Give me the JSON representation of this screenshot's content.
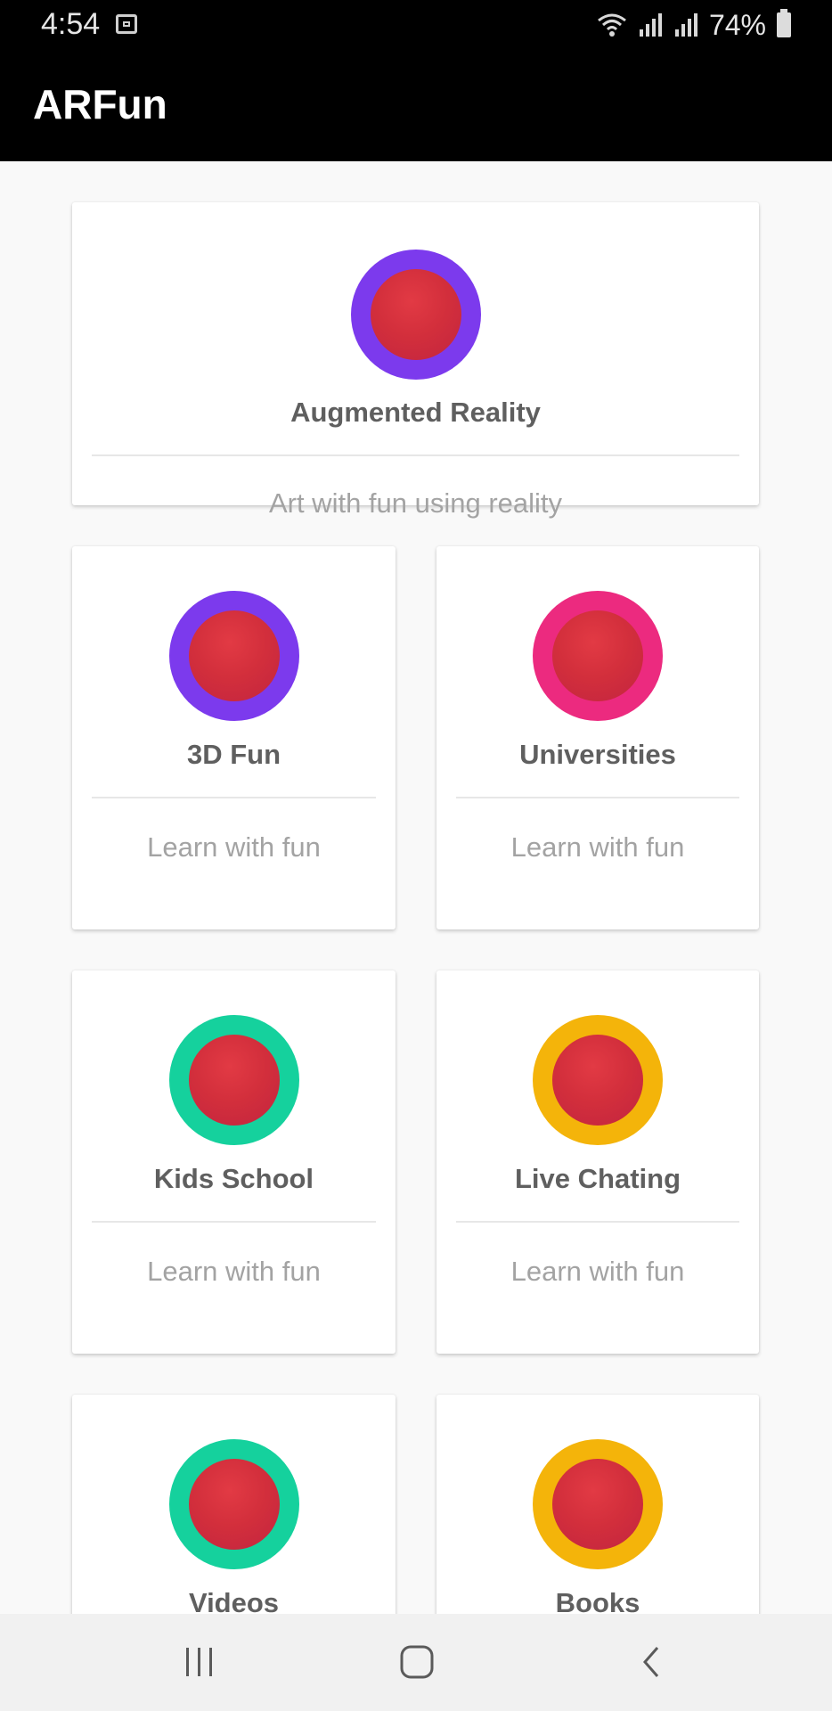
{
  "status_bar": {
    "time": "4:54",
    "battery_percent": "74%",
    "icons": [
      "screen-record-icon",
      "wifi-icon",
      "signal-icon",
      "signal-icon",
      "battery-icon"
    ]
  },
  "app_bar": {
    "title": "ARFun"
  },
  "cards": [
    {
      "title": "Augmented Reality",
      "subtitle": "Art with fun using reality",
      "ring_color": "#7c3aed",
      "icon": "circle-icon"
    },
    {
      "title": "3D Fun",
      "subtitle": "Learn with fun",
      "ring_color": "#7c3aed",
      "icon": "circle-icon"
    },
    {
      "title": "Universities",
      "subtitle": "Learn with fun",
      "ring_color": "#ec2a7f",
      "icon": "circle-icon"
    },
    {
      "title": "Kids School",
      "subtitle": "Learn with fun",
      "ring_color": "#15d19d",
      "icon": "circle-icon"
    },
    {
      "title": "Live Chating",
      "subtitle": "Learn with fun",
      "ring_color": "#f4b40a",
      "icon": "circle-icon"
    },
    {
      "title": "Videos",
      "subtitle": "",
      "ring_color": "#15d19d",
      "icon": "circle-icon"
    },
    {
      "title": "Books",
      "subtitle": "",
      "ring_color": "#f4b40a",
      "icon": "circle-icon"
    }
  ],
  "nav_bar": {
    "buttons": [
      "recent-apps-icon",
      "home-icon",
      "back-icon"
    ]
  }
}
